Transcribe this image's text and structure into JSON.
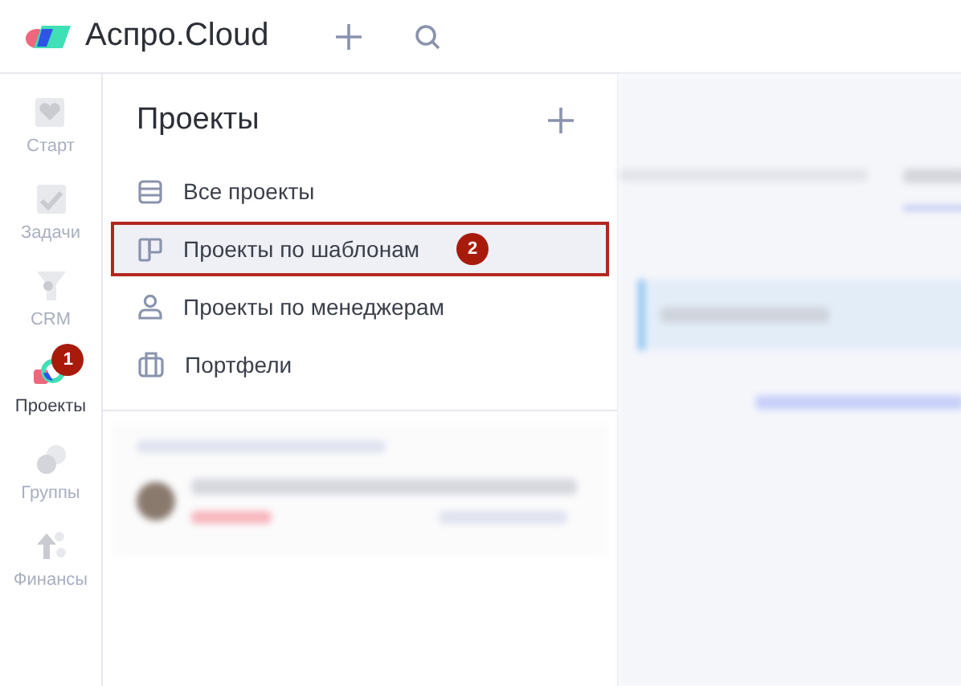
{
  "header": {
    "logo_text": "Аспро.Cloud"
  },
  "sidebar": {
    "items": [
      {
        "label": "Старт",
        "selected": false
      },
      {
        "label": "Задачи",
        "selected": false
      },
      {
        "label": "CRM",
        "selected": false
      },
      {
        "label": "Проекты",
        "selected": true,
        "badge": "1"
      },
      {
        "label": "Группы",
        "selected": false
      },
      {
        "label": "Финансы",
        "selected": false
      }
    ]
  },
  "panel": {
    "title": "Проекты",
    "items": [
      {
        "label": "Все проекты",
        "selected": false
      },
      {
        "label": "Проекты по шаблонам",
        "selected": true,
        "badge": "2"
      },
      {
        "label": "Проекты по менеджерам",
        "selected": false
      },
      {
        "label": "Портфели",
        "selected": false
      }
    ]
  }
}
